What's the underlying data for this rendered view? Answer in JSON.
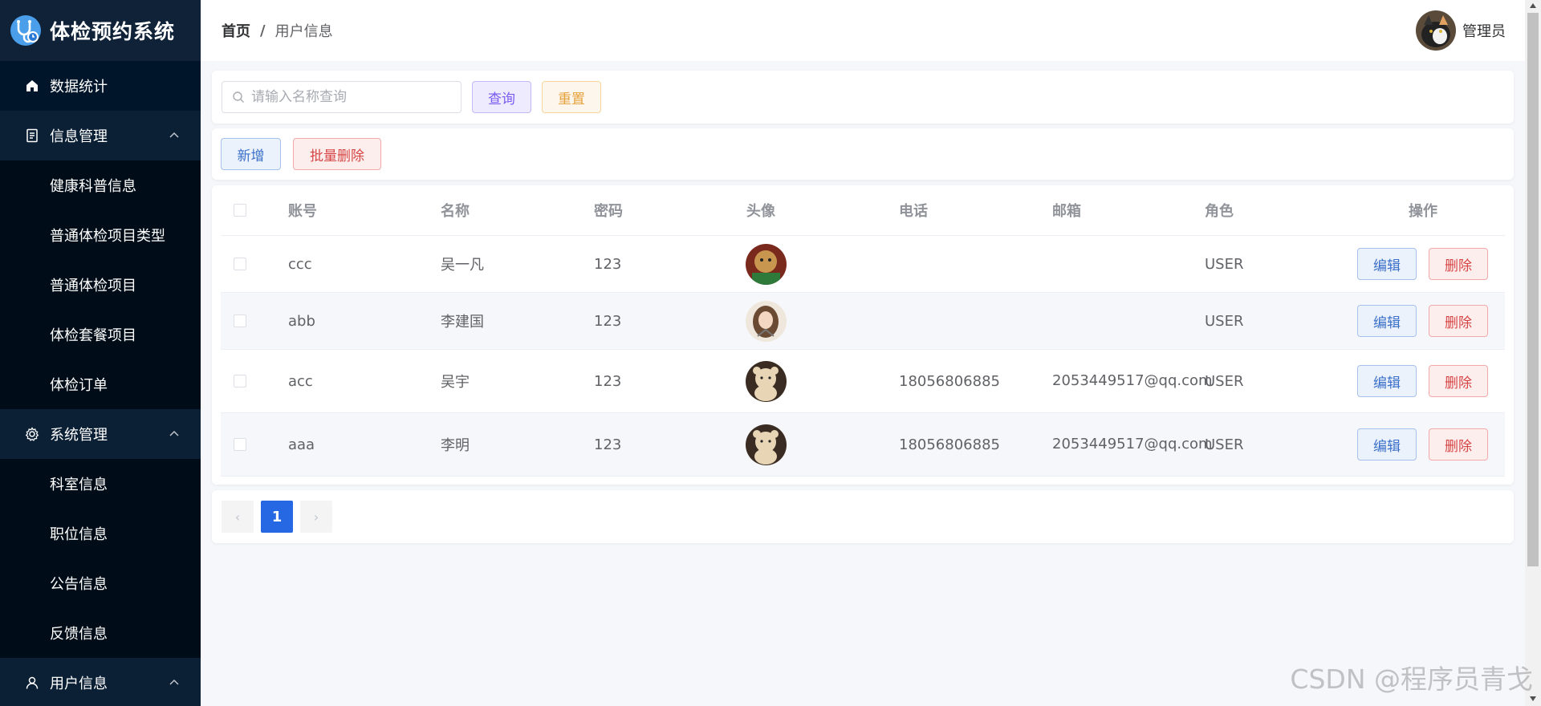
{
  "brand": {
    "title": "体检预约系统"
  },
  "sidebar": {
    "items": [
      {
        "label": "数据统计",
        "type": "item"
      },
      {
        "label": "信息管理",
        "type": "group"
      },
      {
        "label": "健康科普信息",
        "type": "sub"
      },
      {
        "label": "普通体检项目类型",
        "type": "sub"
      },
      {
        "label": "普通体检项目",
        "type": "sub"
      },
      {
        "label": "体检套餐项目",
        "type": "sub"
      },
      {
        "label": "体检订单",
        "type": "sub"
      },
      {
        "label": "系统管理",
        "type": "group"
      },
      {
        "label": "科室信息",
        "type": "sub"
      },
      {
        "label": "职位信息",
        "type": "sub"
      },
      {
        "label": "公告信息",
        "type": "sub"
      },
      {
        "label": "反馈信息",
        "type": "sub"
      },
      {
        "label": "用户信息",
        "type": "group"
      }
    ]
  },
  "header": {
    "breadcrumb_home": "首页",
    "breadcrumb_sep": "/",
    "breadcrumb_current": "用户信息",
    "user_name": "管理员"
  },
  "search": {
    "placeholder": "请输入名称查询",
    "value": "",
    "query_label": "查询",
    "reset_label": "重置"
  },
  "ops": {
    "add_label": "新增",
    "batch_delete_label": "批量删除"
  },
  "table": {
    "columns": [
      "账号",
      "名称",
      "密码",
      "头像",
      "电话",
      "邮箱",
      "角色",
      "操作"
    ],
    "rows": [
      {
        "account": "ccc",
        "name": "吴一凡",
        "password": "123",
        "phone": "",
        "email": "",
        "role": "USER"
      },
      {
        "account": "abb",
        "name": "李建国",
        "password": "123",
        "phone": "",
        "email": "",
        "role": "USER"
      },
      {
        "account": "acc",
        "name": "吴宇",
        "password": "123",
        "phone": "18056806885",
        "email": "2053449517@qq.com",
        "role": "USER"
      },
      {
        "account": "aaa",
        "name": "李明",
        "password": "123",
        "phone": "18056806885",
        "email": "2053449517@qq.com",
        "role": "USER"
      }
    ],
    "edit_label": "编辑",
    "delete_label": "删除"
  },
  "pager": {
    "prev": "‹",
    "current": "1",
    "next": "›"
  },
  "watermark": "CSDN @程序员青戈",
  "colors": {
    "sidebar_bg": "#001529",
    "primary": "#2667e4",
    "danger": "#d64545",
    "warning": "#e6a23c",
    "purple": "#7a5bf0"
  }
}
